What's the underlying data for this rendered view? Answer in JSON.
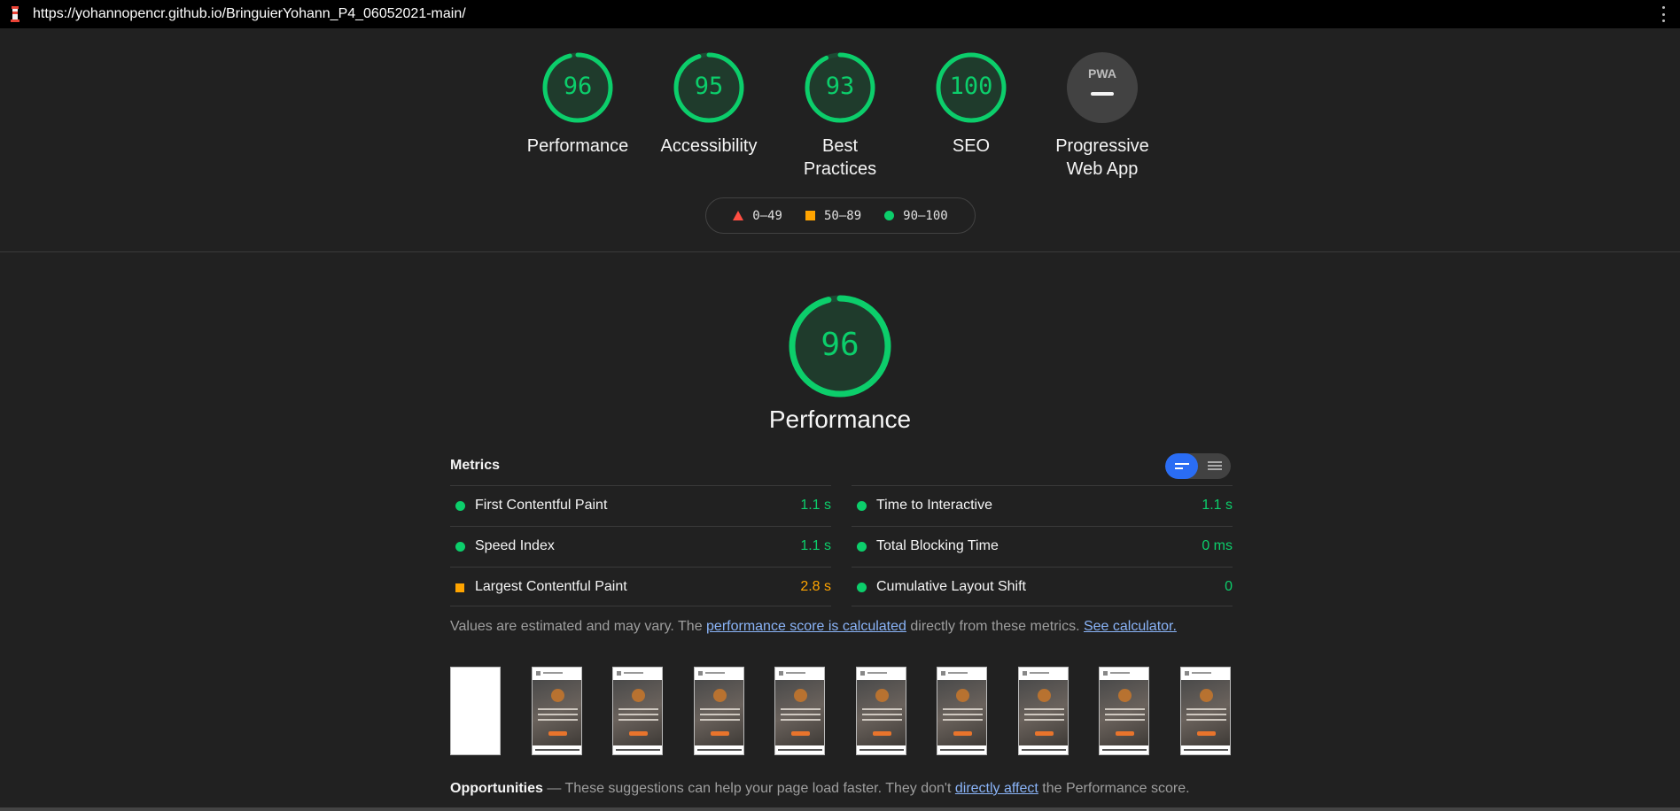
{
  "browser": {
    "url": "https://yohannopencr.github.io/BringuierYohann_P4_06052021-main/"
  },
  "colors": {
    "pass": "#0cce6b",
    "average": "#ffa400",
    "fail": "#ff4e42",
    "toggle_accent": "#2a6df4",
    "link": "#8ab4f8"
  },
  "gauges": [
    {
      "score": "96",
      "label": "Performance"
    },
    {
      "score": "95",
      "label": "Accessibility"
    },
    {
      "score": "93",
      "label": "Best Practices"
    },
    {
      "score": "100",
      "label": "SEO"
    },
    {
      "badge": "PWA",
      "label_line1": "Progressive",
      "label_line2": "Web App"
    }
  ],
  "legend": {
    "fail": "0–49",
    "average": "50–89",
    "pass": "90–100"
  },
  "performance": {
    "score": "96",
    "title": "Performance"
  },
  "metrics": {
    "heading": "Metrics",
    "left": [
      {
        "name": "First Contentful Paint",
        "value": "1.1 s",
        "rating": "pass"
      },
      {
        "name": "Speed Index",
        "value": "1.1 s",
        "rating": "pass"
      },
      {
        "name": "Largest Contentful Paint",
        "value": "2.8 s",
        "rating": "average"
      }
    ],
    "right": [
      {
        "name": "Time to Interactive",
        "value": "1.1 s",
        "rating": "pass"
      },
      {
        "name": "Total Blocking Time",
        "value": "0 ms",
        "rating": "pass"
      },
      {
        "name": "Cumulative Layout Shift",
        "value": "0",
        "rating": "pass"
      }
    ]
  },
  "note": {
    "text1": "Values are estimated and may vary. The ",
    "link1": "performance score is calculated",
    "text2": " directly from these metrics. ",
    "link2": "See calculator."
  },
  "filmstrip": {
    "frames": 10,
    "first_frame_blank": true
  },
  "opportunities": {
    "title": "Opportunities",
    "text1": " — These suggestions can help your page load faster. They don't ",
    "link": "directly affect",
    "text2": " the Performance score."
  }
}
